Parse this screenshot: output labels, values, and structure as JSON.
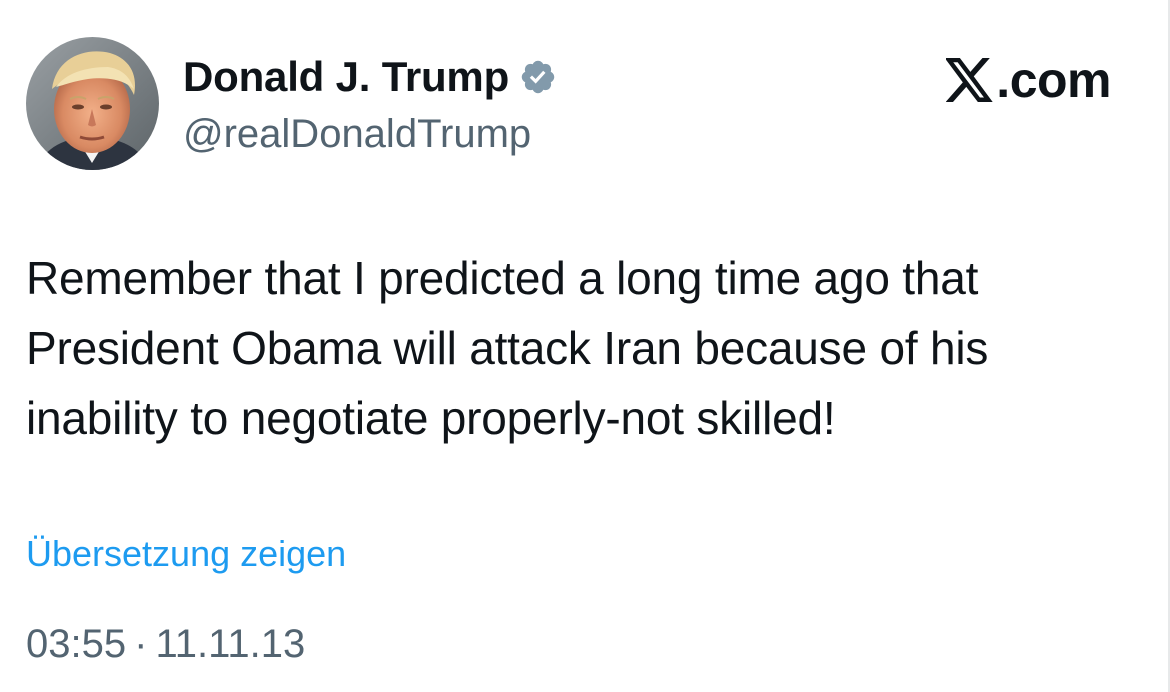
{
  "author": {
    "display_name": "Donald J. Trump",
    "handle": "@realDonaldTrump",
    "verified_icon": "verified-badge-icon",
    "avatar_icon": "profile-photo"
  },
  "brand": {
    "logo_icon": "x-logo-icon",
    "text": ".com"
  },
  "tweet": {
    "text": "Remember that I predicted a long time ago that President Obama will attack Iran because of his inability to negotiate properly-not skilled!",
    "translate_label": "Übersetzung zeigen",
    "time": "03:55",
    "separator": "·",
    "date": "11.11.13"
  },
  "colors": {
    "text_primary": "#0f1419",
    "text_secondary": "#536471",
    "link": "#1d9bf0",
    "verified_badge": "#829aab",
    "background": "#ffffff"
  }
}
